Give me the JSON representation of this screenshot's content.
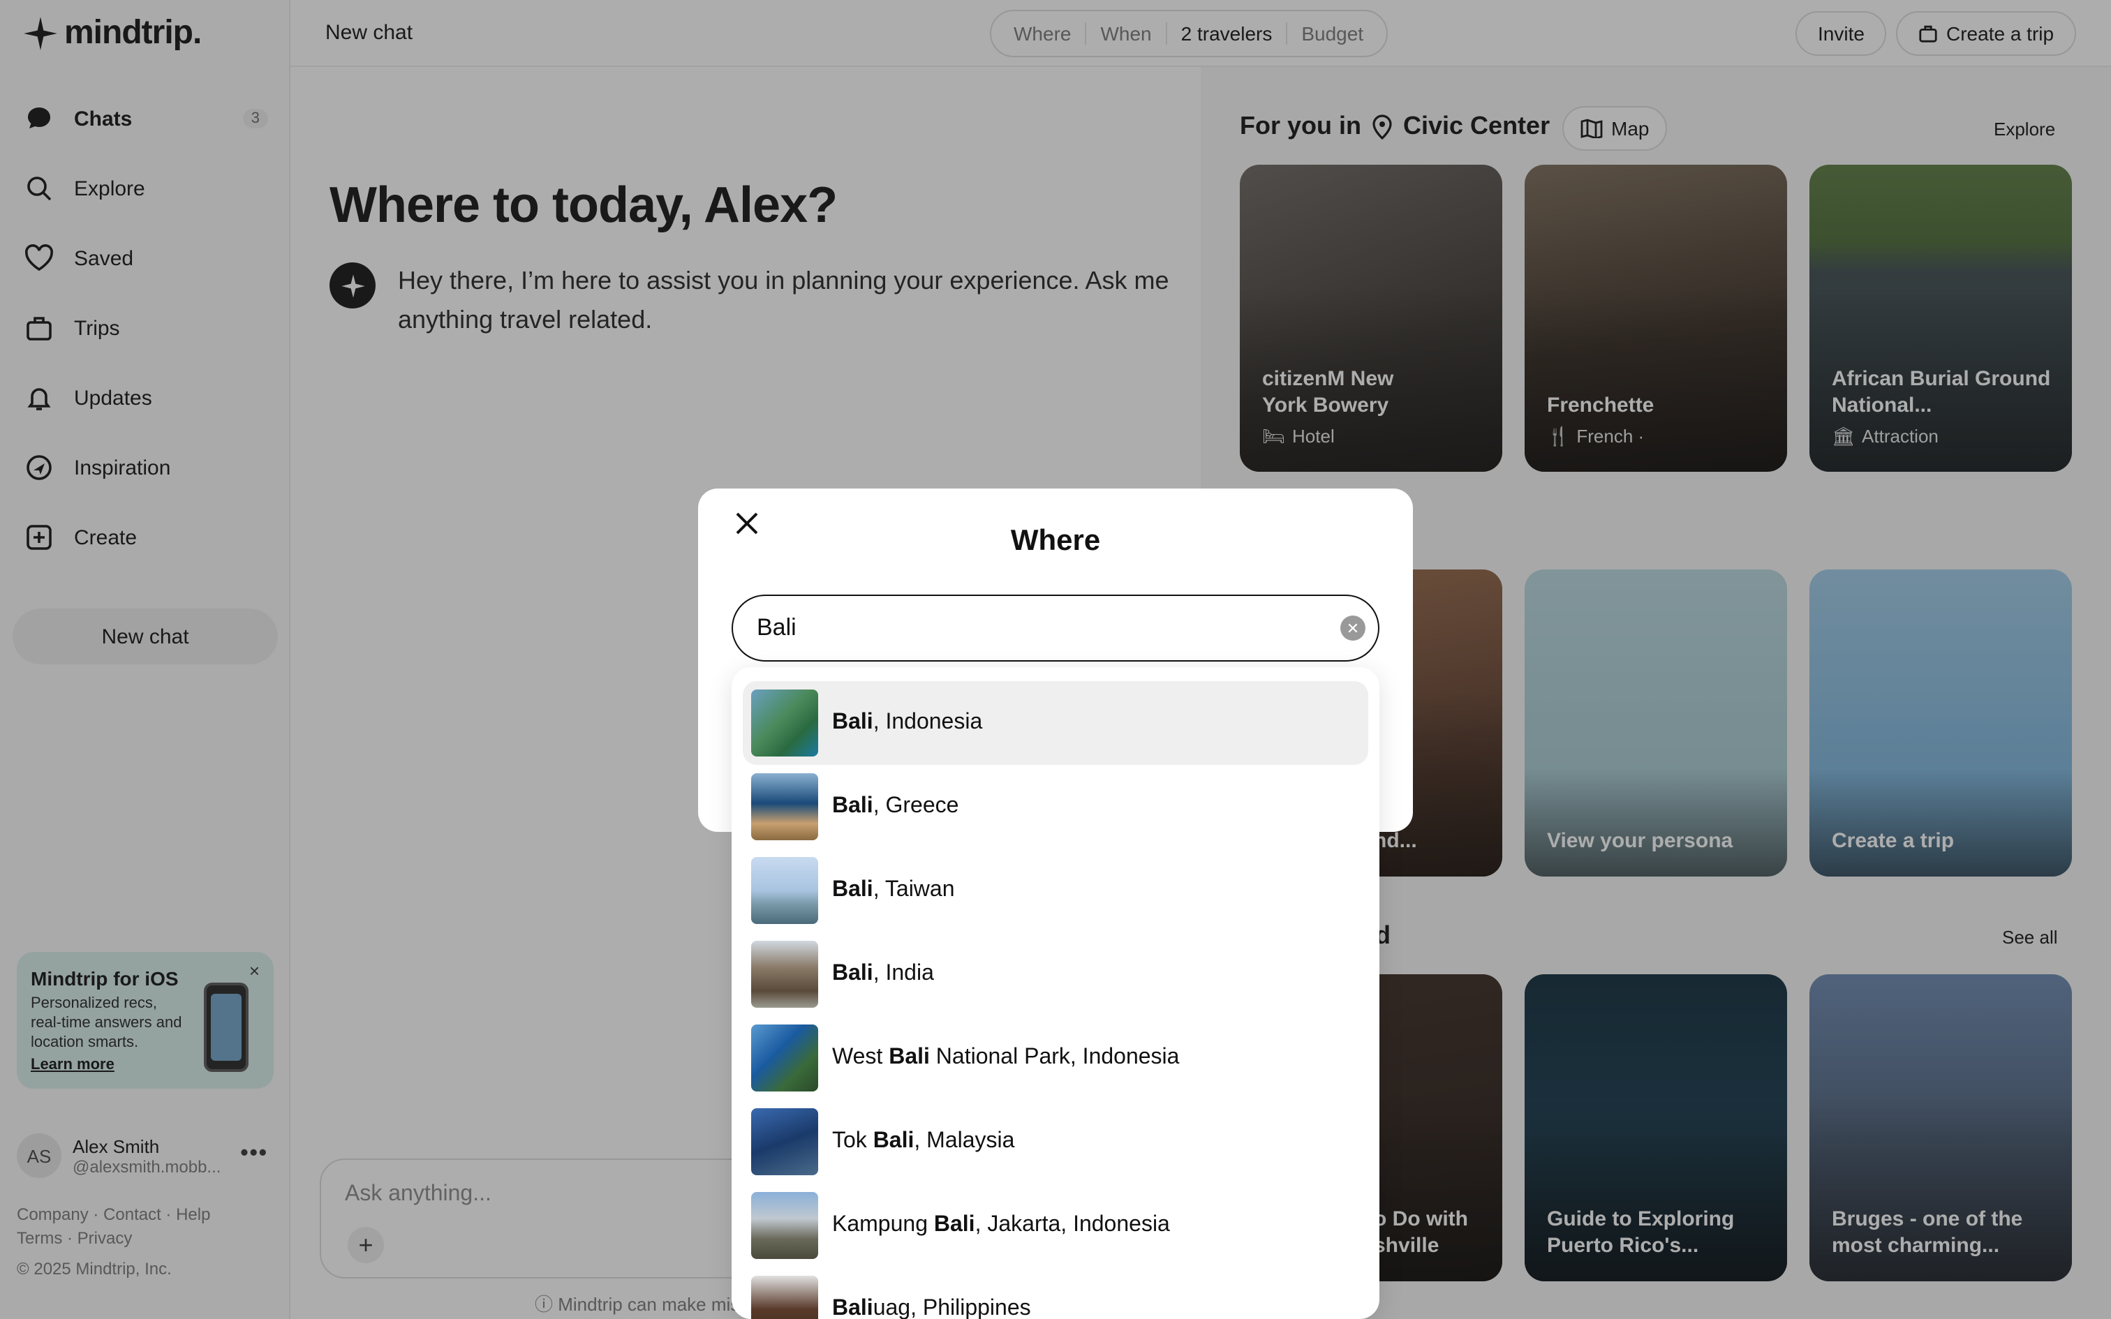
{
  "app": {
    "logo_text": "mindtrip.",
    "chat_title": "New chat"
  },
  "sidebar": {
    "items": [
      {
        "label": "Chats",
        "icon": "chat-bubble-icon",
        "badge": "3"
      },
      {
        "label": "Explore",
        "icon": "search-icon"
      },
      {
        "label": "Saved",
        "icon": "heart-icon"
      },
      {
        "label": "Trips",
        "icon": "suitcase-icon"
      },
      {
        "label": "Updates",
        "icon": "bell-icon"
      },
      {
        "label": "Inspiration",
        "icon": "compass-icon"
      },
      {
        "label": "Create",
        "icon": "plus-square-icon"
      }
    ],
    "new_chat_label": "New chat",
    "promo": {
      "title": "Mindtrip for iOS",
      "text": "Personalized recs, real-time answers and location smarts.",
      "link": "Learn more",
      "close": "×"
    },
    "user": {
      "initials": "AS",
      "name": "Alex Smith",
      "handle": "@alexsmith.mobb..."
    },
    "footer": {
      "line1": "Company · Contact · Help",
      "line2": "Terms · Privacy",
      "copyright": "© 2025 Mindtrip, Inc."
    }
  },
  "topbar": {
    "filters": [
      "Where",
      "When",
      "2 travelers",
      "Budget"
    ],
    "invite_label": "Invite",
    "create_trip_label": "Create a trip"
  },
  "main": {
    "greeting": "Where to today, Alex?",
    "assistant_message": "Hey there, I’m here to assist you in planning your experience. Ask me anything travel related.",
    "input_placeholder": "Ask anything...",
    "disclaimer": "ⓘ Mindtrip can make mis"
  },
  "right_panel": {
    "for_you_label": "For you in",
    "location": "Civic Center",
    "map_label": "Map",
    "explore_label": "Explore",
    "see_all_label": "See all",
    "section_peek": "d",
    "cards_row1": [
      {
        "title": "citizenM New York Bowery",
        "sub": "Hotel"
      },
      {
        "title": "Frenchette",
        "sub": "French ·"
      },
      {
        "title": "African Burial Ground National...",
        "sub": "Attraction"
      }
    ],
    "cards_row2": [
      {
        "title": "nd..."
      },
      {
        "title": "View your persona"
      },
      {
        "title": "Create a trip"
      }
    ],
    "cards_row3": [
      {
        "title": "o Do with shville"
      },
      {
        "title": "Guide to Exploring Puerto Rico's..."
      },
      {
        "title": "Bruges - one of the most charming..."
      }
    ]
  },
  "modal": {
    "title": "Where",
    "search_value": "Bali",
    "options": [
      {
        "pre": "",
        "match": "Bali",
        "post": ", Indonesia",
        "highlighted": true
      },
      {
        "pre": "",
        "match": "Bali",
        "post": ", Greece"
      },
      {
        "pre": "",
        "match": "Bali",
        "post": ", Taiwan"
      },
      {
        "pre": "",
        "match": "Bali",
        "post": ", India"
      },
      {
        "pre": "West ",
        "match": "Bali",
        "post": " National Park, Indonesia"
      },
      {
        "pre": "Tok ",
        "match": "Bali",
        "post": ", Malaysia"
      },
      {
        "pre": "Kampung ",
        "match": "Bali",
        "post": ", Jakarta, Indonesia"
      },
      {
        "pre": "",
        "match": "Bali",
        "post": "uag, Philippines"
      }
    ]
  }
}
